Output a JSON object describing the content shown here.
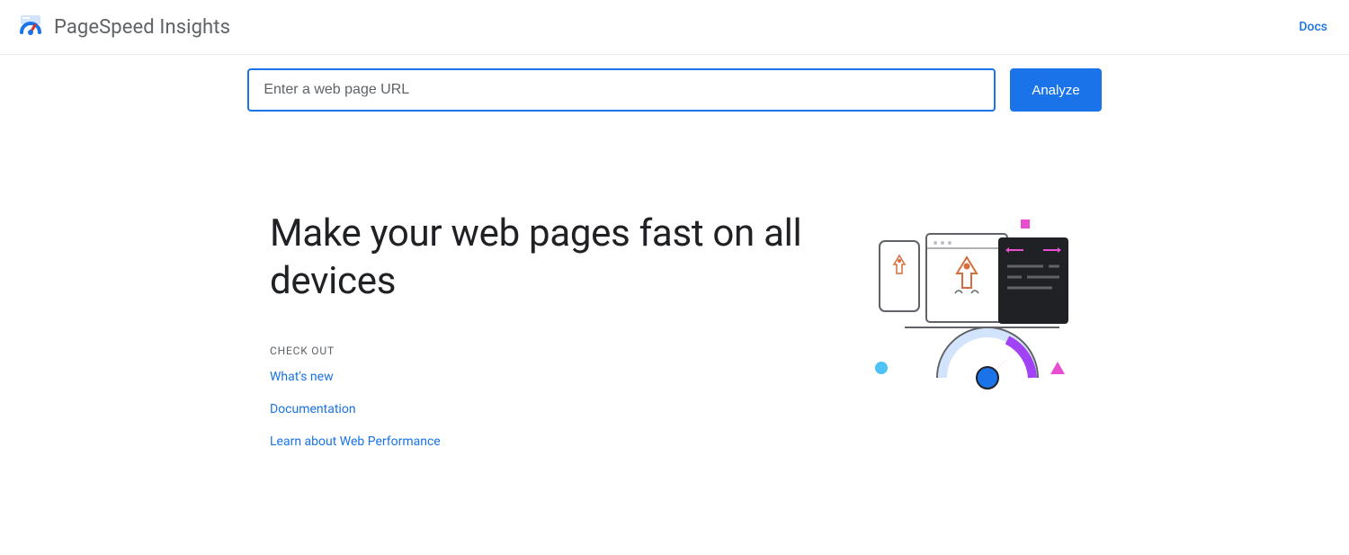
{
  "header": {
    "title": "PageSpeed Insights",
    "docs_label": "Docs"
  },
  "search": {
    "placeholder": "Enter a web page URL",
    "value": "",
    "analyze_label": "Analyze"
  },
  "hero": {
    "headline": "Make your web pages fast on all devices",
    "checkout_label": "CHECK OUT",
    "links": [
      "What's new",
      "Documentation",
      "Learn about Web Performance"
    ]
  }
}
